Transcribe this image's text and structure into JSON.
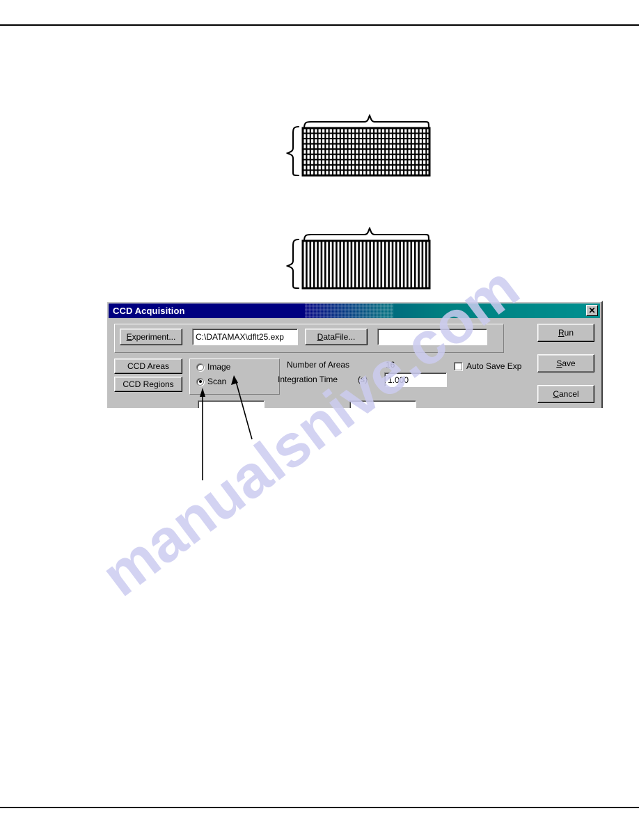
{
  "page": {
    "rule_top": "",
    "rule_bottom": "",
    "watermark": "manualsnive.com"
  },
  "figures": [
    {
      "name": "image-mode-array",
      "caption": "",
      "columns": 34,
      "rows": 9,
      "type": "grid"
    },
    {
      "name": "scan-mode-array",
      "caption": "",
      "columns": 34,
      "rows": 1,
      "type": "stripes"
    }
  ],
  "dialog": {
    "title": "CCD Acquisition",
    "close_label": "✕",
    "experiment_button": "Experiment...",
    "experiment_button_accel": "E",
    "experiment_path": "C:\\DATAMAX\\dflt25.exp",
    "datafile_button": "DataFile...",
    "datafile_button_accel": "D",
    "datafile_value": "",
    "ccd_areas_button": "CCD Areas",
    "ccd_regions_button": "CCD Regions",
    "mode": {
      "image_label": "Image",
      "image_selected": false,
      "scan_label": "Scan",
      "scan_selected": true
    },
    "number_of_areas_label": "Number of Areas",
    "number_of_areas_value": "16",
    "integration_time_label": "Integration Time",
    "integration_time_unit": "(s)",
    "integration_time_value": "1.000",
    "auto_save_label": "Auto Save Exp",
    "auto_save_checked": false,
    "run_button": "Run",
    "run_button_accel": "R",
    "save_button": "Save",
    "save_button_accel": "S",
    "cancel_button": "Cancel",
    "cancel_button_accel": "C",
    "clipped_row": {
      "left_value": "",
      "mid_label": "",
      "right_value": ""
    }
  },
  "annotations": {
    "arrow_to_scan": "",
    "arrow_to_image": ""
  }
}
